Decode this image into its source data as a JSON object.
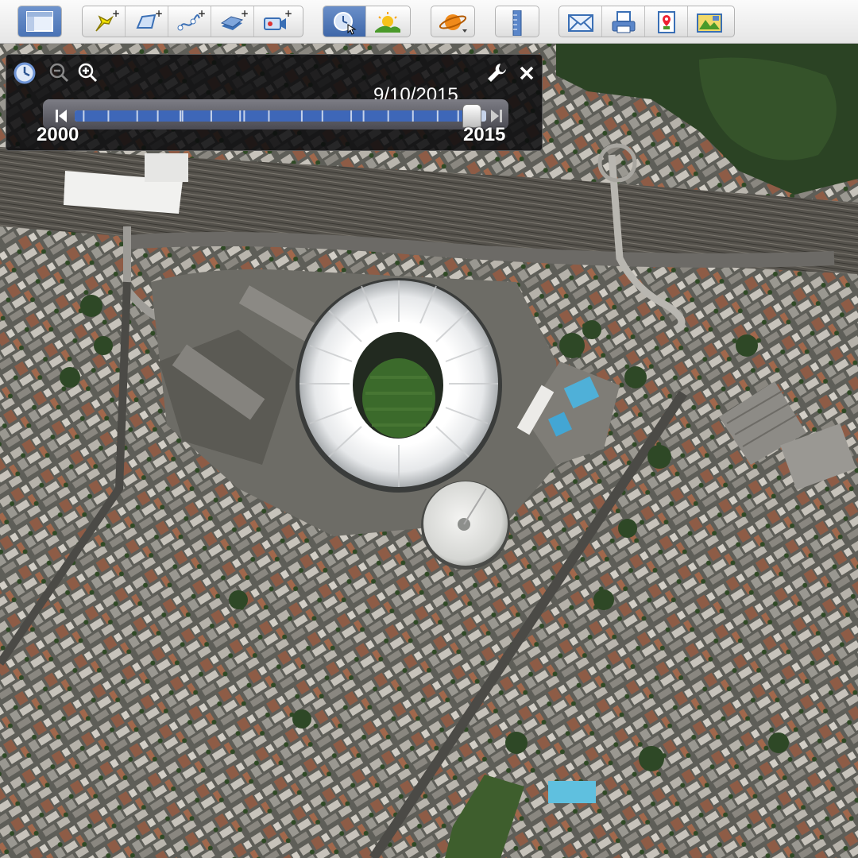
{
  "toolbar": {
    "buttons": [
      {
        "name": "hide-sidebar-button",
        "icon": "sidebar-panel-icon"
      },
      {
        "name": "add-placemark-button",
        "icon": "pushpin-add-icon"
      },
      {
        "name": "add-polygon-button",
        "icon": "polygon-add-icon"
      },
      {
        "name": "add-path-button",
        "icon": "path-add-icon"
      },
      {
        "name": "add-image-overlay-button",
        "icon": "image-overlay-add-icon"
      },
      {
        "name": "record-tour-button",
        "icon": "camera-tour-add-icon"
      },
      {
        "name": "historical-imagery-button",
        "icon": "clock-history-icon",
        "active": true
      },
      {
        "name": "sunlight-button",
        "icon": "sunlight-landscape-icon"
      },
      {
        "name": "switch-planet-button",
        "icon": "planet-icon"
      },
      {
        "name": "ruler-button",
        "icon": "ruler-icon"
      },
      {
        "name": "email-button",
        "icon": "envelope-icon"
      },
      {
        "name": "print-button",
        "icon": "printer-icon"
      },
      {
        "name": "view-in-maps-button",
        "icon": "map-pin-icon"
      },
      {
        "name": "save-image-button",
        "icon": "save-image-icon"
      }
    ]
  },
  "time_slider": {
    "current_date": "9/10/2015",
    "start_year": "2000",
    "end_year": "2015",
    "position": 0.965
  },
  "colors": {
    "accent": "#3e67b8",
    "panel": "#0c0c0e"
  }
}
